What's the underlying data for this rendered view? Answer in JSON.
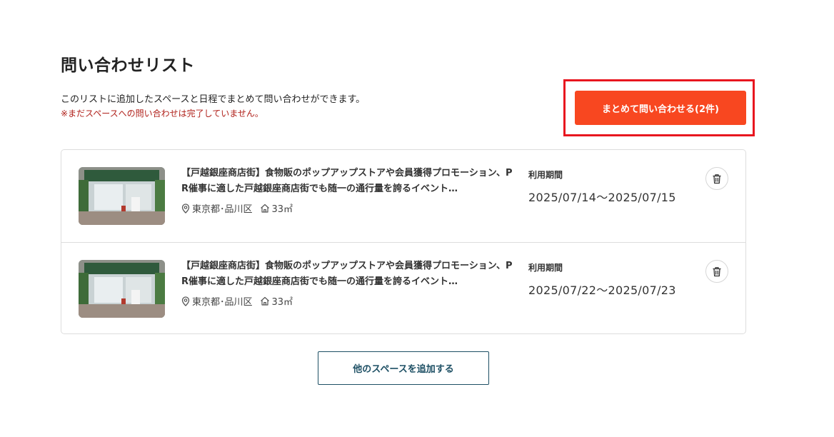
{
  "page": {
    "title": "問い合わせリスト",
    "description": "このリストに追加したスペースと日程でまとめて問い合わせができます。",
    "warning": "※まだスペースへの問い合わせは完了していません。",
    "inquire_button": "まとめて問い合わせる(2件)",
    "add_button": "他のスペースを追加する"
  },
  "colors": {
    "accent": "#f84720",
    "highlight": "#e8161f",
    "warning": "#b0201a",
    "secondary_button": "#1d4f64"
  },
  "items": [
    {
      "title": "【戸越銀座商店街】食物販のポップアップストアや会員獲得プロモーション、PR催事に適した戸越銀座商店街でも随一の通行量を誇るイベント…",
      "location": "東京都･品川区",
      "area": "33㎡",
      "period_label": "利用期間",
      "period": "2025/07/14〜2025/07/15",
      "location_icon": "map-pin-icon",
      "area_icon": "house-icon",
      "delete_icon": "trash-icon"
    },
    {
      "title": "【戸越銀座商店街】食物販のポップアップストアや会員獲得プロモーション、PR催事に適した戸越銀座商店街でも随一の通行量を誇るイベント…",
      "location": "東京都･品川区",
      "area": "33㎡",
      "period_label": "利用期間",
      "period": "2025/07/22〜2025/07/23",
      "location_icon": "map-pin-icon",
      "area_icon": "house-icon",
      "delete_icon": "trash-icon"
    }
  ]
}
